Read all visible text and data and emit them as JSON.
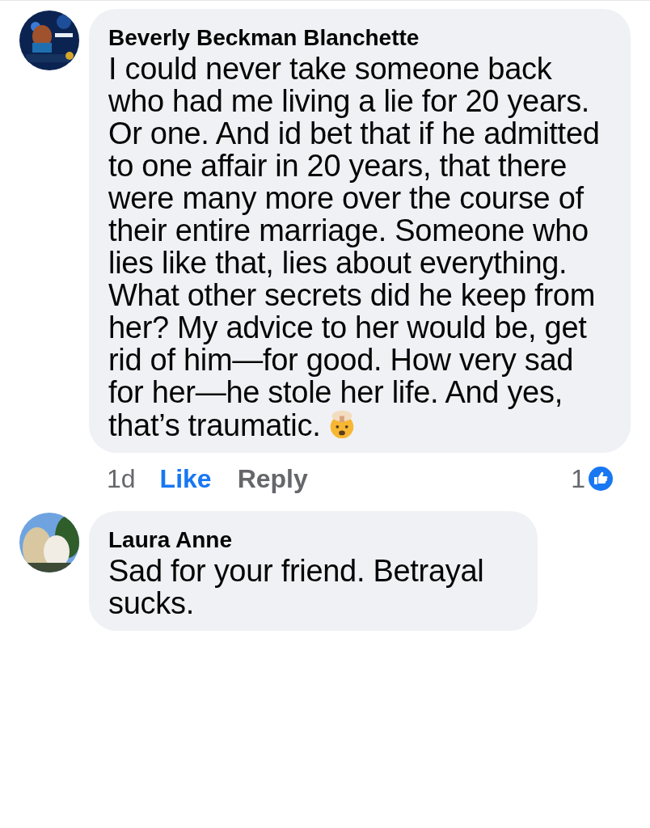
{
  "comments": [
    {
      "author": "Beverly Beckman Blanchette",
      "text": "I could never take someone back who had me living a lie for 20 years. Or one. And id bet that if he admitted to one affair in 20 years, that there were many more over the course of their entire marriage. Someone who lies like that, lies about everything. What other secrets did he keep from her? My advice to her would be, get rid of him—for good. How very sad for her—he stole her life. And yes, that’s traumatic.",
      "emoji": true,
      "time": "1d",
      "like": {
        "label": "Like",
        "selected": true
      },
      "reply": "Reply",
      "reaction_count": "1"
    },
    {
      "author": "Laura Anne",
      "text": "Sad for your friend. Betrayal sucks.",
      "emoji": false
    }
  ]
}
